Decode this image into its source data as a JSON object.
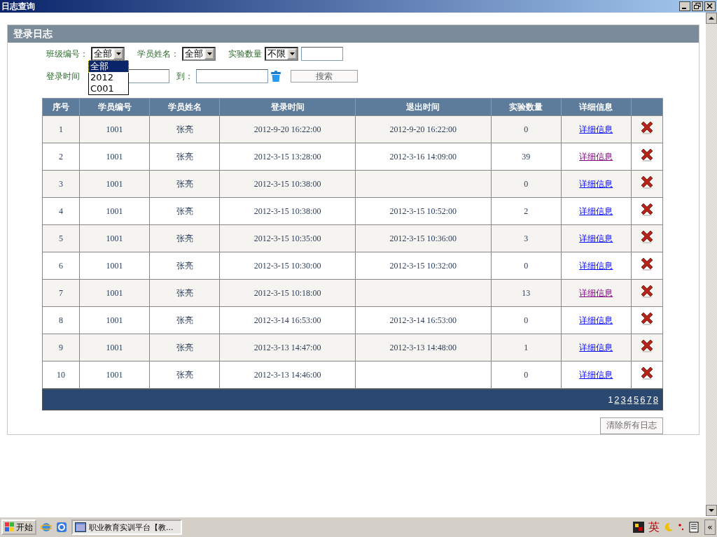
{
  "window": {
    "title": "日志查询"
  },
  "panel": {
    "title": "登录日志"
  },
  "filters": {
    "class_select": {
      "label": "班级编号：",
      "value": "全部",
      "expanded": true,
      "options": [
        {
          "label": "全部",
          "selected": true
        },
        {
          "label": "2012",
          "selected": false
        },
        {
          "label": "C001",
          "selected": false
        }
      ]
    },
    "name_select": {
      "label": "学员姓名：",
      "value": "全部"
    },
    "count_select": {
      "label": "实验数量",
      "value": "不限"
    },
    "date_from_label": "登录时间",
    "date_to_label": "到：",
    "search_button": "搜索"
  },
  "table": {
    "columns": [
      "序号",
      "学员编号",
      "学员姓名",
      "登录时间",
      "退出时间",
      "实验数量",
      "详细信息"
    ],
    "rows": [
      {
        "cells": [
          "1",
          "1001",
          "张亮",
          "2012-9-20 16:22:00",
          "2012-9-20 16:22:00",
          "0"
        ],
        "link": "详细信息",
        "visited": false
      },
      {
        "cells": [
          "2",
          "1001",
          "张亮",
          "2012-3-15 13:28:00",
          "2012-3-16 14:09:00",
          "39"
        ],
        "link": "详细信息",
        "visited": true
      },
      {
        "cells": [
          "3",
          "1001",
          "张亮",
          "2012-3-15 10:38:00",
          "",
          "0"
        ],
        "link": "详细信息",
        "visited": false
      },
      {
        "cells": [
          "4",
          "1001",
          "张亮",
          "2012-3-15 10:38:00",
          "2012-3-15 10:52:00",
          "2"
        ],
        "link": "详细信息",
        "visited": false
      },
      {
        "cells": [
          "5",
          "1001",
          "张亮",
          "2012-3-15 10:35:00",
          "2012-3-15 10:36:00",
          "3"
        ],
        "link": "详细信息",
        "visited": false
      },
      {
        "cells": [
          "6",
          "1001",
          "张亮",
          "2012-3-15 10:30:00",
          "2012-3-15 10:32:00",
          "0"
        ],
        "link": "详细信息",
        "visited": false
      },
      {
        "cells": [
          "7",
          "1001",
          "张亮",
          "2012-3-15 10:18:00",
          "",
          "13"
        ],
        "link": "详细信息",
        "visited": true
      },
      {
        "cells": [
          "8",
          "1001",
          "张亮",
          "2012-3-14 16:53:00",
          "2012-3-14 16:53:00",
          "0"
        ],
        "link": "详细信息",
        "visited": false
      },
      {
        "cells": [
          "9",
          "1001",
          "张亮",
          "2012-3-13 14:47:00",
          "2012-3-13 14:48:00",
          "1"
        ],
        "link": "详细信息",
        "visited": false
      },
      {
        "cells": [
          "10",
          "1001",
          "张亮",
          "2012-3-13 14:46:00",
          "",
          "0"
        ],
        "link": "详细信息",
        "visited": false
      }
    ]
  },
  "pager": [
    {
      "label": "1",
      "selected": true
    },
    {
      "label": "2",
      "selected": false
    },
    {
      "label": "3",
      "selected": false
    },
    {
      "label": "4",
      "selected": false
    },
    {
      "label": "5",
      "selected": false
    },
    {
      "label": "6",
      "selected": false
    },
    {
      "label": "7",
      "selected": false
    },
    {
      "label": "8",
      "selected": false
    }
  ],
  "clear_button": "清除所有日志",
  "taskbar": {
    "start": "开始",
    "task": "职业教育实训平台【教...",
    "ime": "英",
    "collapse": "«"
  }
}
